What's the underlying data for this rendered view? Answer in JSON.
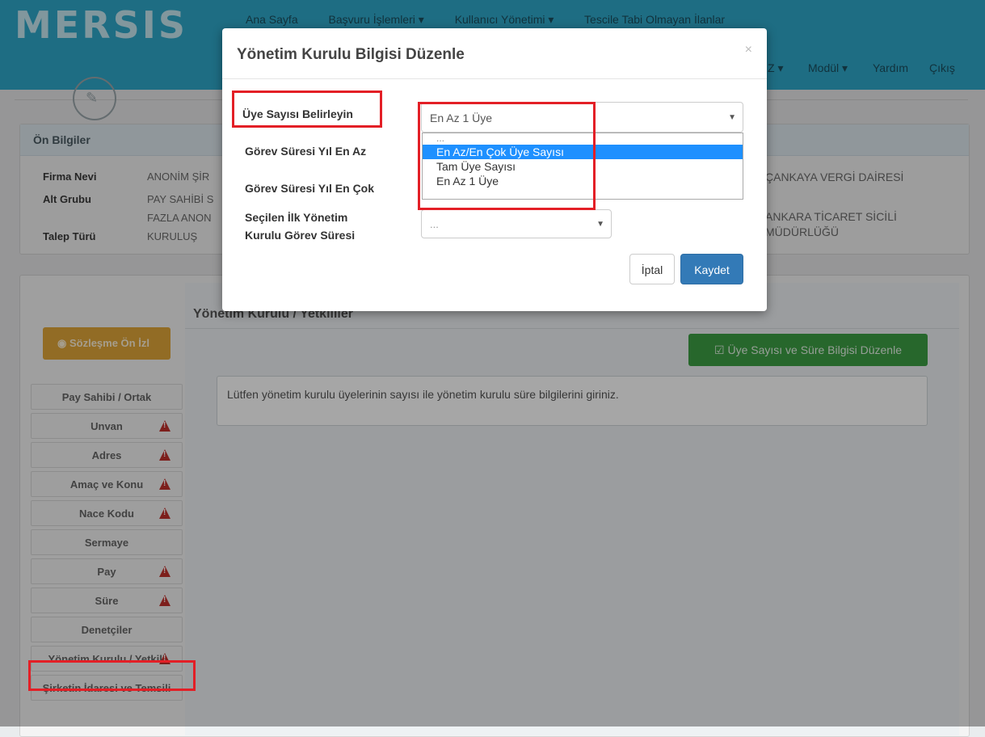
{
  "nav": {
    "logo": "MERSIS",
    "top": [
      "Ana Sayfa",
      "Başvuru İşlemleri ▾",
      "Kullanıcı Yönetimi ▾",
      "Tescile Tabi Olmayan İlanlar"
    ],
    "bot": [
      "Z ▾",
      "Modül ▾",
      "Yardım",
      "Çıkış"
    ]
  },
  "prelim": {
    "title": "Ön Bilgiler",
    "firma_label": "Firma Nevi",
    "firma_value": "ANONİM ŞİR",
    "alt_label": "Alt Grubu",
    "alt_value1": "PAY SAHİBİ S",
    "alt_value2": "FAZLA ANON",
    "talep_label": "Talep Türü",
    "talep_value": "KURULUŞ",
    "right1": "ÇANKAYA VERGİ DAİRESİ",
    "right2": "ANKARA TİCARET SİCİLİ",
    "right3": "MÜDÜRLÜĞÜ"
  },
  "main": {
    "heading": "Yönetim Kurulu / Yetkililer",
    "preview_button": "Sözleşme Ön İzl",
    "edit_button": "Üye Sayısı ve Süre Bilgisi Düzenle",
    "info_text": "Lütfen yönetim kurulu üyelerinin sayısı ile yönetim kurulu süre bilgilerini giriniz."
  },
  "sidebar": [
    {
      "label": "Pay Sahibi / Ortak",
      "warn": false
    },
    {
      "label": "Unvan",
      "warn": true
    },
    {
      "label": "Adres",
      "warn": true
    },
    {
      "label": "Amaç ve Konu",
      "warn": true
    },
    {
      "label": "Nace Kodu",
      "warn": true
    },
    {
      "label": "Sermaye",
      "warn": false
    },
    {
      "label": "Pay",
      "warn": true
    },
    {
      "label": "Süre",
      "warn": true
    },
    {
      "label": "Denetçiler",
      "warn": false
    },
    {
      "label": "Yönetim Kurulu / Yetkili",
      "warn": true
    },
    {
      "label": "Şirketin İdaresi ve Temsili",
      "warn": false
    }
  ],
  "modal": {
    "title": "Yönetim Kurulu Bilgisi Düzenle",
    "close": "×",
    "uye_label": "Üye Sayısı Belirleyin",
    "uye_selected": "En Az 1 Üye",
    "gorev_min_label": "Görev Süresi Yıl En Az",
    "gorev_max_label": "Görev Süresi Yıl En Çok",
    "ilk_label_1": "Seçilen İlk Yönetim",
    "ilk_label_2": "Kurulu Görev Süresi",
    "ilk_value": "...",
    "options": [
      "...",
      "En Az/En Çok Üye Sayısı",
      "Tam Üye Sayısı",
      "En Az 1 Üye"
    ],
    "cancel": "İptal",
    "save": "Kaydet"
  }
}
